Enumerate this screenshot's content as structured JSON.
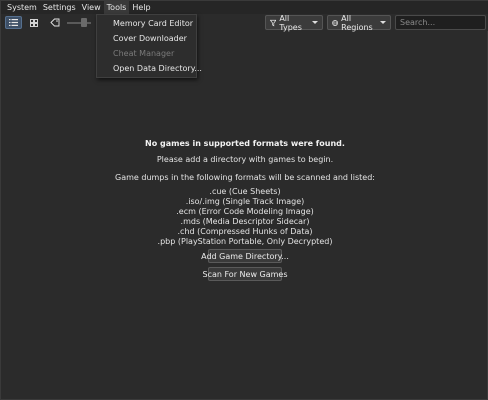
{
  "menubar": {
    "items": [
      {
        "label": "System"
      },
      {
        "label": "Settings"
      },
      {
        "label": "View"
      },
      {
        "label": "Tools"
      },
      {
        "label": "Help"
      }
    ]
  },
  "tools_menu": {
    "items": [
      {
        "label": "Memory Card Editor",
        "enabled": true
      },
      {
        "label": "Cover Downloader",
        "enabled": true
      },
      {
        "label": "Cheat Manager",
        "enabled": false
      },
      {
        "label": "Open Data Directory...",
        "enabled": true
      }
    ]
  },
  "toolbar": {
    "types_label": "All Types",
    "regions_label": "All Regions",
    "search_placeholder": "Search..."
  },
  "empty_state": {
    "title": "No games in supported formats were found.",
    "message": "Please add a directory with games to begin.",
    "formats_heading": "Game dumps in the following formats will be scanned and listed:",
    "formats": [
      ".cue (Cue Sheets)",
      ".iso/.img (Single Track Image)",
      ".ecm (Error Code Modeling Image)",
      ".mds (Media Descriptor Sidecar)",
      ".chd (Compressed Hunks of Data)",
      ".pbp (PlayStation Portable, Only Decrypted)"
    ],
    "add_button": "Add Game Directory...",
    "scan_button": "Scan For New Games"
  }
}
